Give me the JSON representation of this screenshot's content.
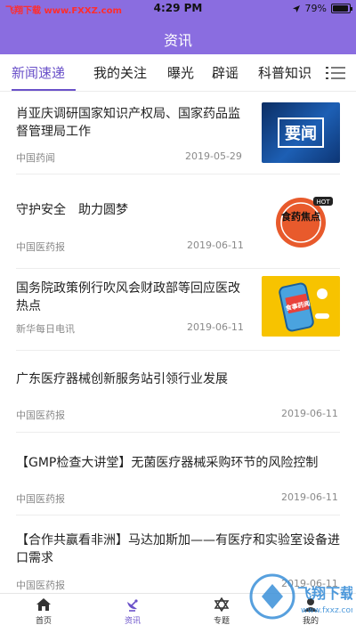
{
  "status": {
    "watermark": "飞翔下载 www.FXXZ.com",
    "time": "4:29 PM",
    "battery": "79%"
  },
  "nav": {
    "title": "资讯"
  },
  "tabs": [
    {
      "label": "新闻速递"
    },
    {
      "label": "我的关注"
    },
    {
      "label": "曝光"
    },
    {
      "label": "辟谣"
    },
    {
      "label": "科普知识"
    }
  ],
  "news": [
    {
      "title": "肖亚庆调研国家知识产权局、国家药品监督管理局工作",
      "source": "中国药闻",
      "date": "2019-05-29",
      "thumb_text": "要闻"
    },
    {
      "title": "守护安全　助力圆梦",
      "source": "中国医药报",
      "date": "2019-06-11",
      "thumb_text": "食药焦点",
      "thumb_badge": "HOT"
    },
    {
      "title": "国务院政策例行吹风会财政部等回应医改热点",
      "source": "新华每日电讯",
      "date": "2019-06-11",
      "thumb_text": "食事药闻"
    },
    {
      "title": "广东医疗器械创新服务站引领行业发展",
      "source": "中国医药报",
      "date": "2019-06-11"
    },
    {
      "title": "【GMP检查大讲堂】无菌医疗器械采购环节的风险控制",
      "source": "中国医药报",
      "date": "2019-06-11"
    },
    {
      "title": "【合作共赢看非洲】马达加斯加——有医疗和实验室设备进口需求",
      "source": "中国医药报",
      "date": "2019-06-11"
    }
  ],
  "bottom_tabs": [
    {
      "label": "首页"
    },
    {
      "label": "资讯"
    },
    {
      "label": "专题"
    },
    {
      "label": "我的"
    }
  ],
  "watermark_br": {
    "brand": "飞翔下载",
    "url": "www.fxxz.com"
  },
  "colors": {
    "accent": "#8a6de0",
    "active_tab": "#6a51c9"
  }
}
